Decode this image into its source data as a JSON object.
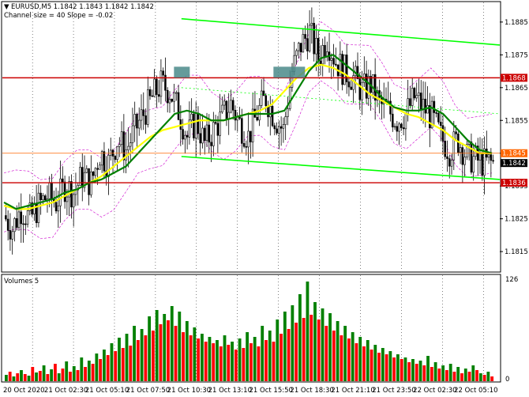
{
  "header": {
    "symbol_line": "EURUSD,M5  1.1842 1.1843 1.1842 1.1842",
    "indicator_line": "Channel size = 40 Slope = -0.02"
  },
  "volume_panel": {
    "label": "Volumes 5",
    "max_label": "126",
    "min_label": "0"
  },
  "colors": {
    "background": "#ffffff",
    "grid": "#000000",
    "bull_candle": "#008000",
    "bear_candle": "#ff0000",
    "fast_ma": "#008000",
    "slow_ma": "#ffff00",
    "channel": "#00ff00",
    "level_lines": "#cc0000",
    "envelope": "#cc00cc",
    "current_price_line": "#ff6600",
    "marker": "#4a8a8a"
  },
  "chart_data": {
    "type": "candlestick",
    "title": "EURUSD,M5",
    "y_ticks": [
      "1.1885",
      "1.1875",
      "1.1865",
      "1.1855",
      "1.1845",
      "1.1835",
      "1.1825",
      "1.1815"
    ],
    "ylim": [
      1.1809,
      1.1891
    ],
    "x_tick_labels": [
      "20 Oct 2020",
      "21 Oct 02:30",
      "21 Oct 05:10",
      "21 Oct 07:50",
      "21 Oct 10:30",
      "21 Oct 13:10",
      "21 Oct 15:50",
      "21 Oct 18:30",
      "21 Oct 21:10",
      "21 Oct 23:50",
      "22 Oct 02:30",
      "22 Oct 05:10"
    ],
    "price_labels": [
      {
        "text": "1.1868",
        "value": 1.1868,
        "role": "support-resistance"
      },
      {
        "text": "1.1845",
        "value": 1.1845,
        "role": "current"
      },
      {
        "text": "1.1842",
        "value": 1.1842,
        "role": "last"
      },
      {
        "text": "1.1836",
        "value": 1.1836,
        "role": "support-resistance"
      }
    ],
    "horizontal_levels": [
      1.1868,
      1.1836
    ],
    "channel_lines": [
      {
        "from": {
          "bar": 0.36,
          "price": 1.1886
        },
        "to": {
          "bar": 1.0,
          "price": 1.1878
        }
      },
      {
        "from": {
          "bar": 0.36,
          "price": 1.1844
        },
        "to": {
          "bar": 1.0,
          "price": 1.1837
        }
      }
    ],
    "price_path": [
      1.1826,
      1.1822,
      1.1828,
      1.1825,
      1.1829,
      1.1832,
      1.183,
      1.1835,
      1.1833,
      1.1838,
      1.1836,
      1.1845,
      1.1842,
      1.1849,
      1.1846,
      1.1852,
      1.1857,
      1.1862,
      1.1866,
      1.1864,
      1.1858,
      1.185,
      1.1855,
      1.1848,
      1.1852,
      1.1856,
      1.186,
      1.1854,
      1.185,
      1.1857,
      1.1862,
      1.1856,
      1.1852,
      1.187,
      1.1878,
      1.1882,
      1.1874,
      1.188,
      1.1873,
      1.187,
      1.1868,
      1.1864,
      1.1866,
      1.186,
      1.1858,
      1.1855,
      1.1857,
      1.1862,
      1.1859,
      1.1856,
      1.185,
      1.1846,
      1.1849,
      1.1844,
      1.1843,
      1.1842,
      1.1842
    ],
    "fast_ma_path": [
      1.183,
      1.1828,
      1.1829,
      1.183,
      1.1831,
      1.1833,
      1.1834,
      1.1836,
      1.1837,
      1.1839,
      1.1841,
      1.1845,
      1.1849,
      1.1853,
      1.1857,
      1.1858,
      1.1857,
      1.1855,
      1.1855,
      1.1856,
      1.1857,
      1.1857,
      1.1857,
      1.1858,
      1.1864,
      1.187,
      1.1874,
      1.1875,
      1.1872,
      1.1869,
      1.1866,
      1.1862,
      1.1859,
      1.1858,
      1.1858,
      1.1859,
      1.1857,
      1.1853,
      1.1849,
      1.1846,
      1.1845
    ],
    "slow_ma_path": [
      1.1829,
      1.1828,
      1.1828,
      1.1829,
      1.183,
      1.1832,
      1.1834,
      1.1836,
      1.1838,
      1.1841,
      1.1844,
      1.1847,
      1.185,
      1.1852,
      1.1853,
      1.1854,
      1.1855,
      1.1855,
      1.1855,
      1.1856,
      1.1857,
      1.1858,
      1.186,
      1.1864,
      1.1868,
      1.1871,
      1.1872,
      1.1871,
      1.1869,
      1.1866,
      1.1863,
      1.1861,
      1.1859,
      1.1857,
      1.1856,
      1.1854,
      1.1852,
      1.1849,
      1.1847,
      1.1845,
      1.1845
    ],
    "volume_ylim": [
      0,
      126
    ],
    "volumes": [
      8,
      12,
      6,
      10,
      14,
      9,
      7,
      18,
      11,
      13,
      20,
      9,
      15,
      22,
      10,
      16,
      25,
      12,
      19,
      14,
      30,
      18,
      26,
      22,
      35,
      28,
      40,
      33,
      48,
      38,
      55,
      42,
      60,
      45,
      70,
      52,
      66,
      58,
      82,
      64,
      90,
      72,
      85,
      77,
      95,
      70,
      88,
      62,
      76,
      58,
      68,
      54,
      60,
      50,
      56,
      48,
      52,
      44,
      58,
      46,
      50,
      40,
      54,
      42,
      62,
      48,
      56,
      44,
      70,
      52,
      64,
      50,
      78,
      60,
      88,
      66,
      96,
      74,
      110,
      80,
      126,
      84,
      100,
      78,
      92,
      70,
      86,
      64,
      76,
      58,
      70,
      54,
      62,
      48,
      56,
      44,
      52,
      40,
      46,
      36,
      42,
      34,
      38,
      30,
      34,
      28,
      30,
      24,
      28,
      22,
      26,
      20,
      32,
      18,
      24,
      16,
      20,
      14,
      22,
      12,
      18,
      10,
      16,
      12,
      20,
      14,
      10,
      8,
      12,
      6
    ]
  }
}
